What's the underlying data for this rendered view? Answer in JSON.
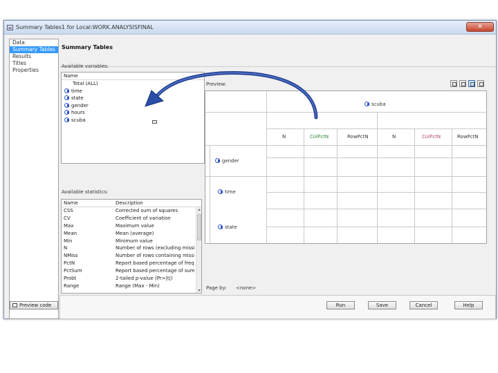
{
  "window": {
    "title": "Summary Tables1 for Local:WORK.ANALYSISFINAL",
    "close_glyph": "✕"
  },
  "nav": {
    "items": [
      {
        "label": "Data",
        "selected": false
      },
      {
        "label": "Summary Tables",
        "selected": true
      },
      {
        "label": "Results",
        "selected": false
      },
      {
        "label": "Titles",
        "selected": false
      },
      {
        "label": "Properties",
        "selected": false
      }
    ]
  },
  "page": {
    "title": "Summary Tables"
  },
  "variables": {
    "label": "Available variables:",
    "header": "Name",
    "total": "Total (ALL)",
    "items": [
      "time",
      "state",
      "gender",
      "hours",
      "scuba"
    ]
  },
  "statistics": {
    "label": "Available statistics:",
    "headers": {
      "name": "Name",
      "description": "Description"
    },
    "rows": [
      {
        "name": "CSS",
        "description": "Corrected sum of squares"
      },
      {
        "name": "CV",
        "description": "Coefficient of variation"
      },
      {
        "name": "Max",
        "description": "Maximum value"
      },
      {
        "name": "Mean",
        "description": "Mean (average)"
      },
      {
        "name": "Min",
        "description": "Minimum value"
      },
      {
        "name": "N",
        "description": "Number of rows (excluding missing..."
      },
      {
        "name": "NMiss",
        "description": "Number of rows containing missing..."
      },
      {
        "name": "PctN",
        "description": "Report based percentage of frequ..."
      },
      {
        "name": "PctSum",
        "description": "Report based percentage of sum (..."
      },
      {
        "name": "Probt",
        "description": "2-tailed p-value (Pr>|t|)"
      },
      {
        "name": "Range",
        "description": "Range (Max - Min)"
      }
    ]
  },
  "preview": {
    "label": "Preview:",
    "column_variable": "scuba",
    "column_stats": [
      "N",
      "ColPctN",
      "RowPctN",
      "N",
      "ColPctN",
      "RowPctN"
    ],
    "row_variables": [
      "gender",
      "time",
      "state"
    ]
  },
  "page_by": {
    "label": "Page by:",
    "value": "<none>"
  },
  "buttons": {
    "preview_code": "Preview code",
    "run": "Run",
    "save": "Save",
    "cancel": "Cancel",
    "help": "Help"
  }
}
